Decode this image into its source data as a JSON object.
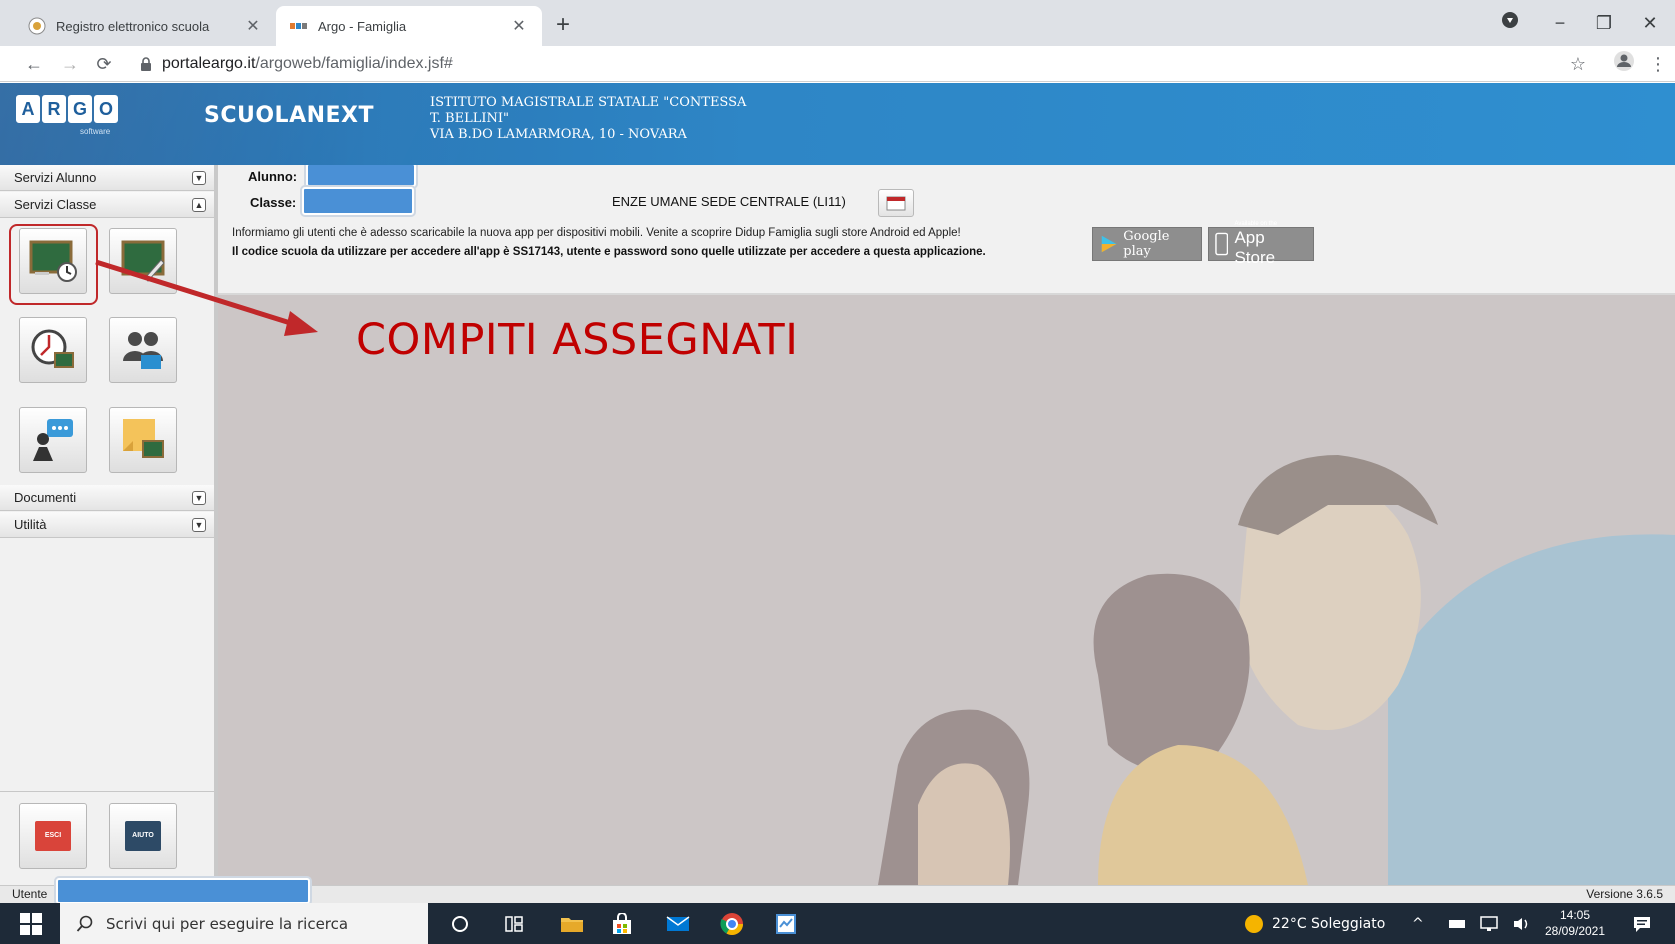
{
  "browser": {
    "tabs": [
      {
        "title": "Registro elettronico scuola",
        "active": false
      },
      {
        "title": "Argo - Famiglia",
        "active": true
      }
    ],
    "new_tab_label": "+",
    "url_host": "portaleargo.it",
    "url_path": "/argoweb/famiglia/index.jsf#"
  },
  "header": {
    "logo_letters": [
      "A",
      "R",
      "G",
      "O"
    ],
    "logo_sub": "software",
    "product": "SCUOLANEXT",
    "school_line1": "ISTITUTO MAGISTRALE STATALE \"CONTESSA",
    "school_line2": "T. BELLINI\"",
    "school_line3": "VIA B.DO LAMARMORA, 10 - NOVARA"
  },
  "sidebar": {
    "panels": {
      "servizi_alunno": "Servizi Alunno",
      "servizi_classe": "Servizi Classe",
      "documenti": "Documenti",
      "utilita": "Utilità"
    },
    "exit_label": "ESCI",
    "help_label": "AIUTO"
  },
  "main": {
    "alunno_label": "Alunno:",
    "classe_label": "Classe:",
    "classe_value_visible": "ENZE UMANE SEDE CENTRALE (LI11)",
    "info_line1": "Informiamo gli utenti che è adesso scaricabile la nuova app per dispositivi mobili. Venite a scoprire Didup Famiglia sugli store Android ed Apple!",
    "info_line2": "Il codice scuola da utilizzare per accedere all'app è SS17143, utente e password sono quelle utilizzate per accedere a questa applicazione.",
    "google_play": "Google play",
    "app_store_small": "Available on the",
    "app_store": "App Store",
    "annotation": "COMPITI ASSEGNATI"
  },
  "status": {
    "utente_label": "Utente",
    "version": "Versione 3.6.5"
  },
  "taskbar": {
    "search_placeholder": "Scrivi qui per eseguire la ricerca",
    "weather": "22°C Soleggiato",
    "time": "14:05",
    "date": "28/09/2021"
  },
  "colors": {
    "header_blue": "#2e86c6",
    "annotation_red": "#c00000",
    "redaction_blue": "#4a90d6",
    "main_bg": "#ccc6c6"
  }
}
